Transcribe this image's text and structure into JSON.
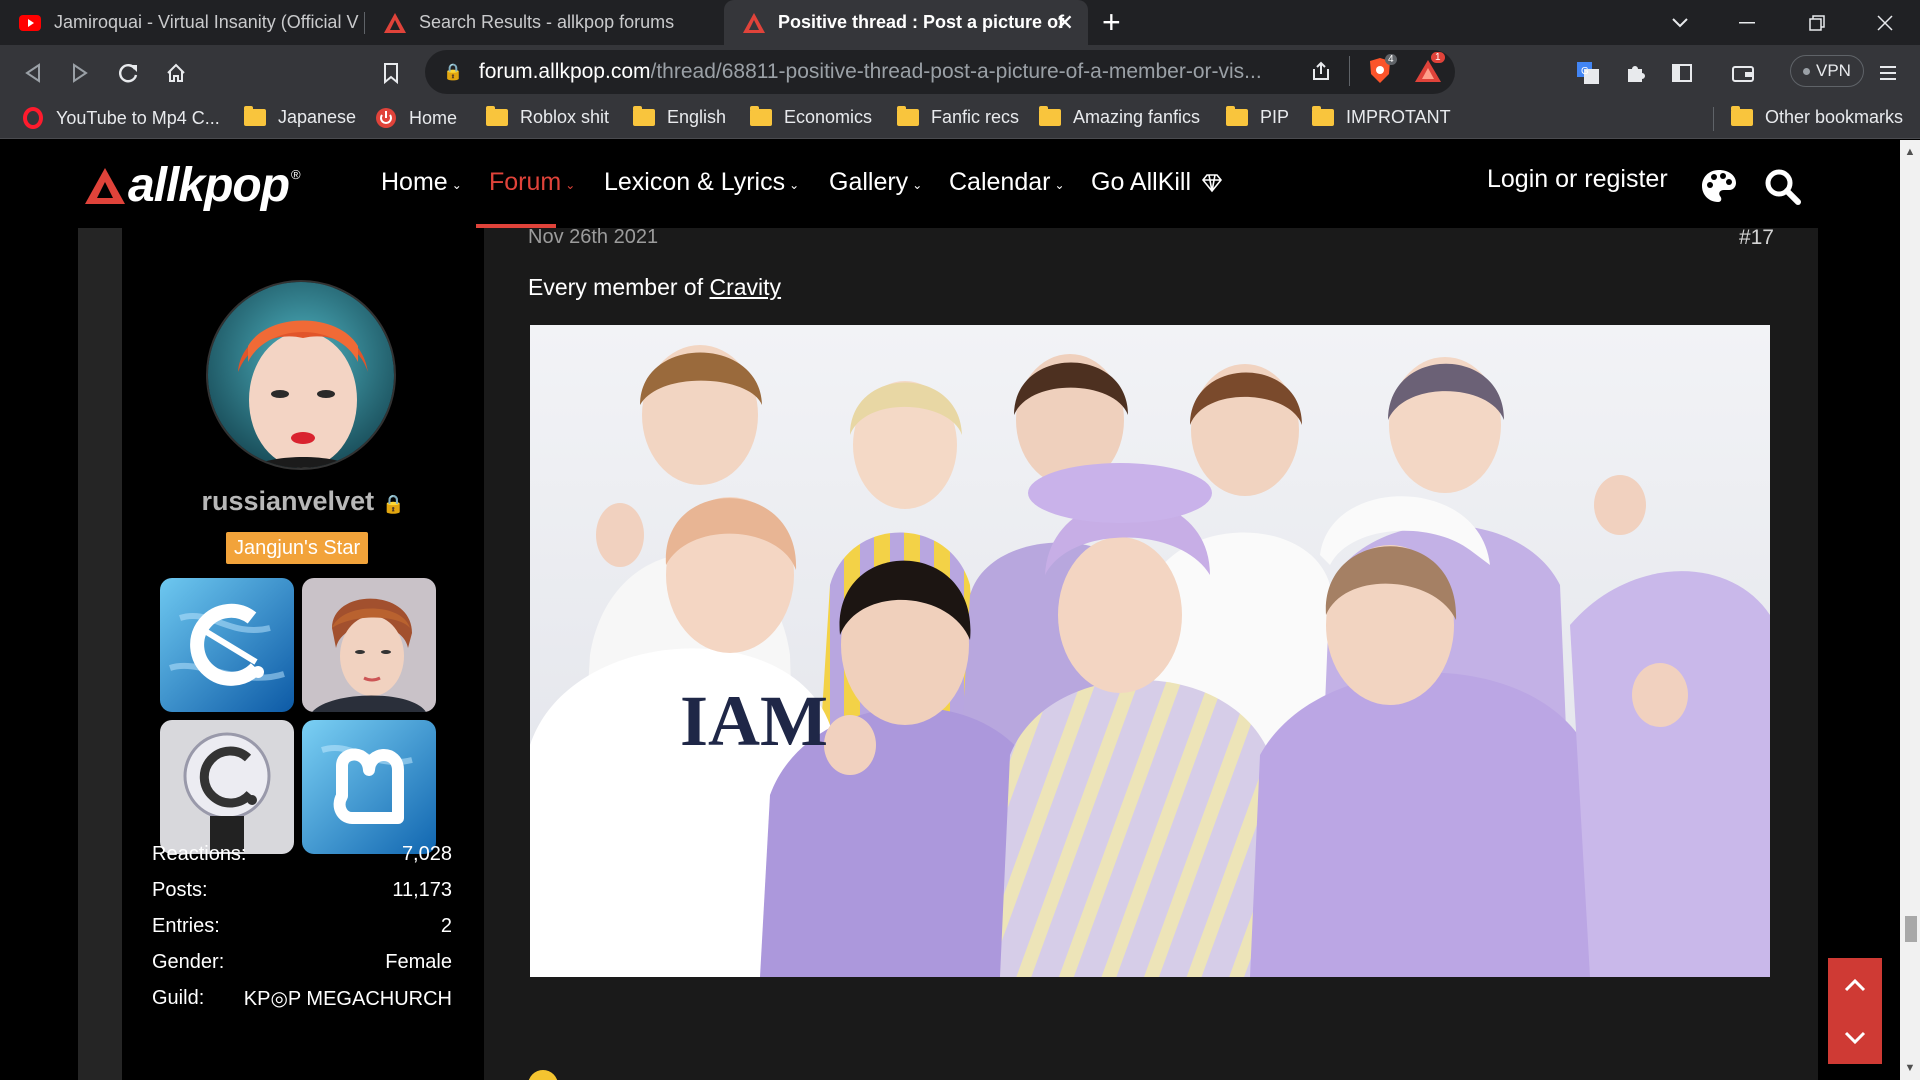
{
  "browser": {
    "tabs": [
      {
        "title": "Jamiroquai - Virtual Insanity (Official V",
        "favicon": "youtube-icon"
      },
      {
        "title": "Search Results - allkpop forums",
        "favicon": "allkpop-icon"
      },
      {
        "title": "Positive thread : Post a picture of",
        "favicon": "allkpop-icon",
        "active": true
      }
    ],
    "new_tab_label": "+",
    "url_host": "forum.allkpop.com",
    "url_path": "/thread/68811-positive-thread-post-a-picture-of-a-member-or-vis...",
    "vpn_label": "VPN",
    "badges": {
      "brave_shield_count": "4",
      "alert_count": "1"
    },
    "bookmarks": [
      {
        "label": "YouTube to Mp4 C...",
        "icon": "opera-icon"
      },
      {
        "label": "Japanese",
        "icon": "folder-icon"
      },
      {
        "label": "Home",
        "icon": "power-icon"
      },
      {
        "label": "Roblox shit",
        "icon": "folder-icon"
      },
      {
        "label": "English",
        "icon": "folder-icon"
      },
      {
        "label": "Economics",
        "icon": "folder-icon"
      },
      {
        "label": "Fanfic recs",
        "icon": "folder-icon"
      },
      {
        "label": "Amazing fanfics",
        "icon": "folder-icon"
      },
      {
        "label": "PIP",
        "icon": "folder-icon"
      },
      {
        "label": "IMPROTANT",
        "icon": "folder-icon"
      }
    ],
    "other_bookmarks": "Other bookmarks"
  },
  "site": {
    "logo_text": "allkpop",
    "logo_reg": "®",
    "nav": [
      {
        "label": "Home",
        "dropdown": true
      },
      {
        "label": "Forum",
        "dropdown": true,
        "active": true
      },
      {
        "label": "Lexicon & Lyrics",
        "dropdown": true
      },
      {
        "label": "Gallery",
        "dropdown": true
      },
      {
        "label": "Calendar",
        "dropdown": true
      },
      {
        "label": "Go AllKill",
        "dropdown": false
      }
    ],
    "login_label": "Login or register",
    "accent": "#e0433a"
  },
  "user": {
    "name": "russianvelvet",
    "rank_badge": "Jangjun's Star",
    "stats": [
      {
        "label": "Reactions:",
        "value": "7,028"
      },
      {
        "label": "Posts:",
        "value": "11,173"
      },
      {
        "label": "Entries:",
        "value": "2"
      },
      {
        "label": "Gender:",
        "value": "Female"
      },
      {
        "label": "Guild:",
        "value": "KP◎P MEGACHURCH"
      }
    ]
  },
  "post": {
    "date": "Nov 26th 2021",
    "number": "#17",
    "text_prefix": "Every member of ",
    "text_link": "Cravity",
    "image_shirt_text": "IAM"
  }
}
